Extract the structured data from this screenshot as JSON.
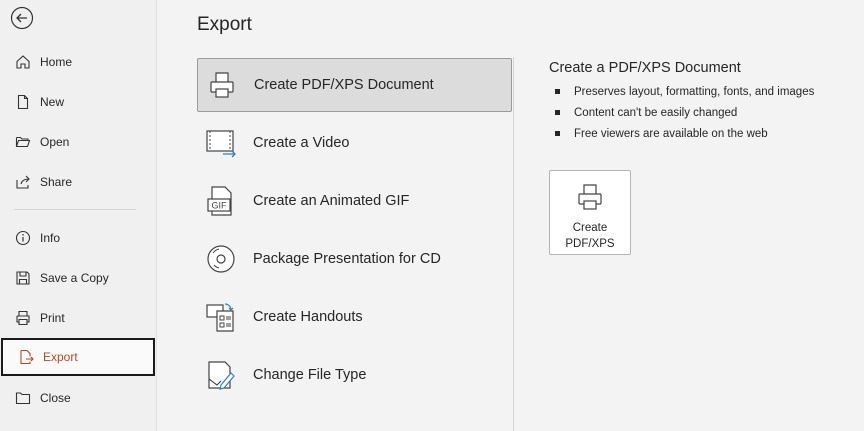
{
  "nav": {
    "items": [
      {
        "label": "Home",
        "icon": "home-icon"
      },
      {
        "label": "New",
        "icon": "new-document-icon"
      },
      {
        "label": "Open",
        "icon": "open-folder-icon"
      },
      {
        "label": "Share",
        "icon": "share-icon"
      },
      {
        "label": "Info",
        "icon": "info-icon"
      },
      {
        "label": "Save a Copy",
        "icon": "save-icon"
      },
      {
        "label": "Print",
        "icon": "printer-icon"
      },
      {
        "label": "Export",
        "icon": "export-icon",
        "active": true
      },
      {
        "label": "Close",
        "icon": "folder-close-icon"
      }
    ]
  },
  "page": {
    "title": "Export"
  },
  "options": [
    {
      "label": "Create PDF/XPS Document",
      "icon": "pdf-printer-icon",
      "selected": true
    },
    {
      "label": "Create a Video",
      "icon": "video-icon"
    },
    {
      "label": "Create an Animated GIF",
      "icon": "gif-icon"
    },
    {
      "label": "Package Presentation for CD",
      "icon": "cd-icon"
    },
    {
      "label": "Create Handouts",
      "icon": "handouts-icon"
    },
    {
      "label": "Change File Type",
      "icon": "change-file-type-icon"
    }
  ],
  "detail": {
    "title": "Create a PDF/XPS Document",
    "bullets": [
      "Preserves layout, formatting, fonts, and images",
      "Content can't be easily changed",
      "Free viewers are available on the web"
    ],
    "button_label": "Create\nPDF/XPS",
    "gif_text": "GIF"
  },
  "colors": {
    "accent": "#b7472a",
    "selected_bg": "#dcdcdc",
    "nav_bg": "#f0f0f0"
  }
}
